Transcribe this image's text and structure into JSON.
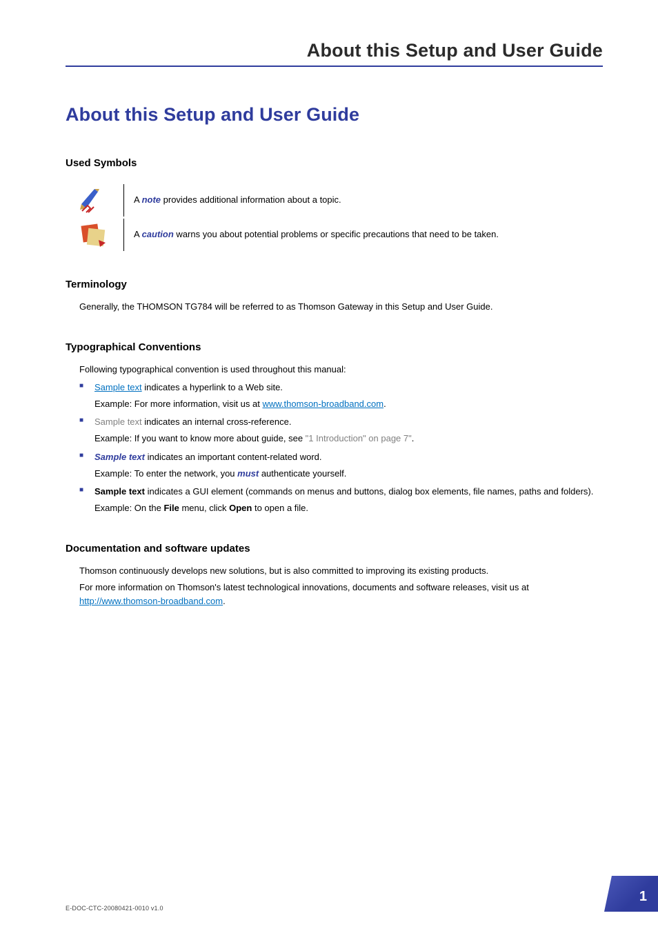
{
  "running_header": "About this Setup and User Guide",
  "title": "About this Setup and User Guide",
  "sections": {
    "used_symbols": {
      "heading": "Used Symbols",
      "note_line": {
        "pre": "A ",
        "key": "note",
        "post": " provides additional information about a topic."
      },
      "caution_line": {
        "pre": "A ",
        "key": "caution",
        "post": " warns you about potential problems or specific precautions that need to be taken."
      }
    },
    "terminology": {
      "heading": "Terminology",
      "text": "Generally, the THOMSON TG784 will be referred to as Thomson Gateway in this Setup and User Guide."
    },
    "typo": {
      "heading": "Typographical Conventions",
      "intro": "Following typographical convention is used throughout this manual:",
      "items": [
        {
          "lead": "Sample text",
          "lead_class": "link-blue",
          "desc": " indicates a hyperlink to a Web site.",
          "example_pre": "Example: For more information, visit us at ",
          "example_link": "www.thomson-broadband.com",
          "example_post": "."
        },
        {
          "lead": "Sample text",
          "lead_class": "xref-gray",
          "desc": " indicates an internal cross-reference.",
          "example_pre": "Example: If you want to know more about guide, see ",
          "example_xref": "\"1 Introduction\" on page 7\"",
          "example_post": "."
        },
        {
          "lead": "Sample text",
          "lead_class": "emph-purple",
          "desc": " indicates an important content-related word.",
          "example_pre": "Example: To enter the network, you ",
          "example_strong": "must",
          "example_post": " authenticate yourself."
        },
        {
          "lead": "Sample text",
          "lead_class": "gui-bold",
          "desc": " indicates a GUI element (commands on menus and buttons, dialog box elements, file names, paths and folders).",
          "example_pre": "Example: On the ",
          "example_b1": "File",
          "example_mid": " menu, click ",
          "example_b2": "Open",
          "example_post": " to open a file."
        }
      ]
    },
    "updates": {
      "heading": "Documentation and software updates",
      "p1": "Thomson continuously develops new solutions, but is also committed to improving its existing products.",
      "p2_pre": "For more information on Thomson's latest technological innovations, documents and software releases, visit us at ",
      "p2_link": "http://www.thomson-broadband.com",
      "p2_post": "."
    }
  },
  "footer": {
    "doc_id": "E-DOC-CTC-20080421-0010 v1.0",
    "page": "1"
  }
}
